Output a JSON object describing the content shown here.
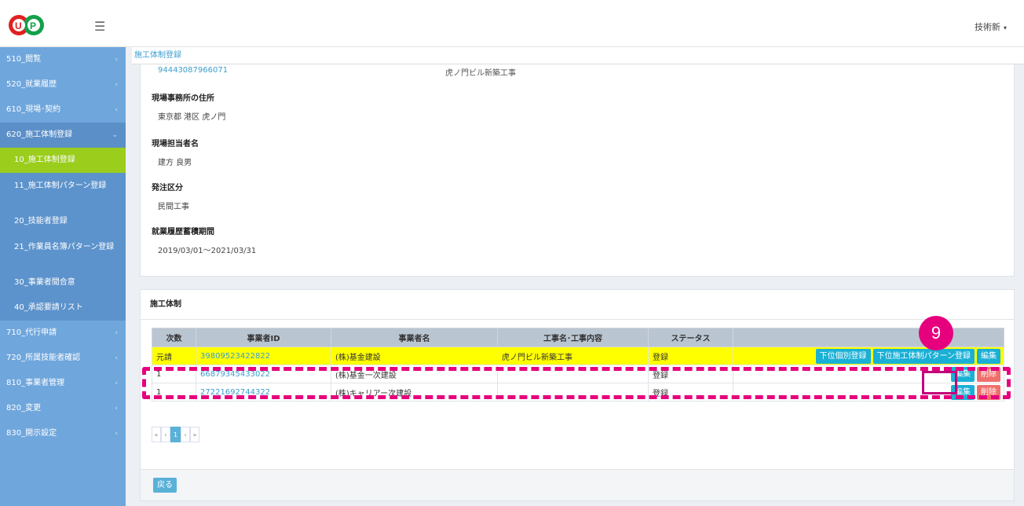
{
  "header": {
    "logo_text": "UP",
    "menu_icon": "☰",
    "user_name": "技術新",
    "user_caret": "▾"
  },
  "sidebar": {
    "items": [
      {
        "label": "510_閲覧",
        "arrow": "‹"
      },
      {
        "label": "520_就業履歴",
        "arrow": "‹"
      },
      {
        "label": "610_現場･契約",
        "arrow": "‹"
      },
      {
        "label": "620_施工体制登録",
        "arrow": "⌄"
      },
      {
        "label": "710_代行申請",
        "arrow": "‹"
      },
      {
        "label": "720_所属技能者確認",
        "arrow": "‹"
      },
      {
        "label": "810_事業者管理",
        "arrow": "‹"
      },
      {
        "label": "820_変更",
        "arrow": "‹"
      },
      {
        "label": "830_開示設定",
        "arrow": "‹"
      }
    ],
    "sub_items": [
      {
        "label": "10_施工体制登録"
      },
      {
        "label": "11_施工体制パターン登録"
      },
      {
        "label": "20_技能者登録"
      },
      {
        "label": "21_作業員名簿パターン登録"
      },
      {
        "label": "30_事業者間合意"
      },
      {
        "label": "40_承認要請リスト"
      }
    ]
  },
  "breadcrumb": {
    "current": "施工体制登録"
  },
  "details": {
    "top_id": "94443087966071",
    "top_name": "虎ノ門ビル新築工事",
    "fields": [
      {
        "label": "現場事務所の住所",
        "value": "東京都 港区 虎ノ門"
      },
      {
        "label": "現場担当者名",
        "value": "建方 良男"
      },
      {
        "label": "発注区分",
        "value": "民間工事"
      },
      {
        "label": "就業履歴蓄積期間",
        "value": "2019/03/01～2021/03/31"
      }
    ]
  },
  "structure": {
    "title": "施工体制",
    "columns": [
      "次数",
      "事業者ID",
      "事業者名",
      "工事名･工事内容",
      "ステータス",
      ""
    ],
    "rows": [
      {
        "level": "元請",
        "id": "39809523422822",
        "name": "(株)基金建設",
        "work": "虎ノ門ビル新築工事",
        "status": "登録"
      },
      {
        "level": "1",
        "id": "66879345433022",
        "name": "(株)基金一次建設",
        "work": "",
        "status": "登録"
      },
      {
        "level": "1",
        "id": "27221692744322",
        "name": "(株)キャリアー次建設",
        "work": "",
        "status": "登録"
      }
    ],
    "buttons": {
      "sub_register": "下位個別登録",
      "sub_pattern": "下位施工体制パターン登録",
      "edit": "編集",
      "delete": "削除"
    },
    "pager": [
      "«",
      "‹",
      "1",
      "›",
      "»"
    ],
    "back": "戻る"
  },
  "annotation": {
    "step": "9"
  },
  "colors": {
    "sidebar": "#6fa6dc",
    "active_item": "#9acd1c",
    "accent": "#e6007e",
    "highlight_row": "#ffff00"
  }
}
